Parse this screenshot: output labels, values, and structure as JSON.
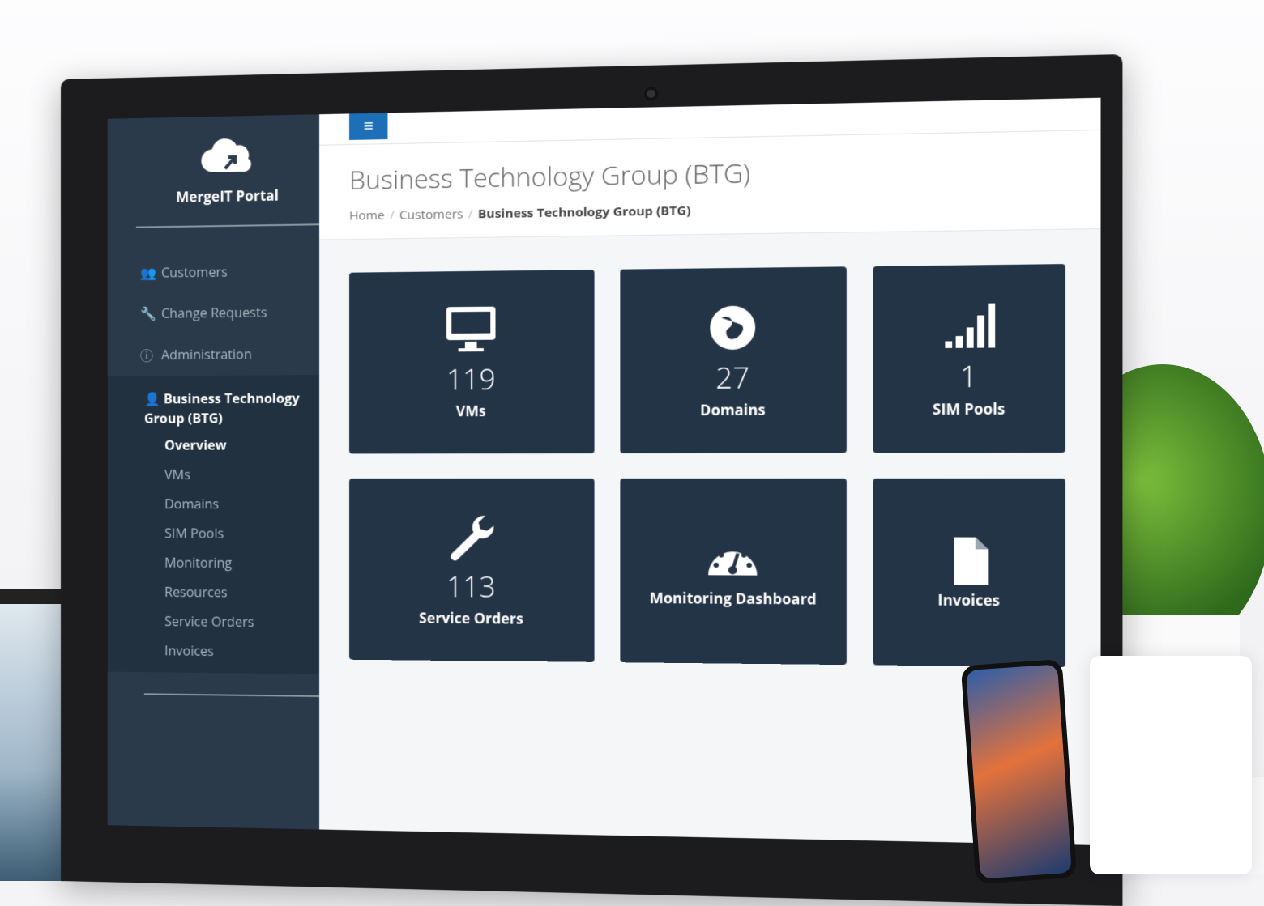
{
  "app": {
    "name": "MergeIT Portal"
  },
  "sidebar": {
    "items": [
      {
        "label": "Customers",
        "icon": "users-icon"
      },
      {
        "label": "Change Requests",
        "icon": "wrench-icon"
      },
      {
        "label": "Administration",
        "icon": "info-icon"
      }
    ],
    "group": {
      "title": "Business Technology Group (BTG)",
      "icon": "user-icon",
      "items": [
        "Overview",
        "VMs",
        "Domains",
        "SIM Pools",
        "Monitoring",
        "Resources",
        "Service Orders",
        "Invoices"
      ]
    }
  },
  "topbar": {
    "menu_icon": "≡"
  },
  "header": {
    "title": "Business Technology Group (BTG)",
    "breadcrumb": [
      "Home",
      "Customers",
      "Business Technology Group (BTG)"
    ],
    "separator": "/"
  },
  "tiles": [
    {
      "count": "119",
      "label": "VMs",
      "icon": "monitor-icon"
    },
    {
      "count": "27",
      "label": "Domains",
      "icon": "globe-icon"
    },
    {
      "count": "1",
      "label": "SIM Pools",
      "icon": "signal-icon"
    },
    {
      "count": "113",
      "label": "Service Orders",
      "icon": "wrench-icon"
    },
    {
      "label": "Monitoring Dashboard",
      "icon": "dashboard-icon"
    },
    {
      "label": "Invoices",
      "icon": "file-icon"
    }
  ],
  "colors": {
    "sidebar": "#2b3a4a",
    "tile": "#243447",
    "accent": "#1d6fb8"
  }
}
